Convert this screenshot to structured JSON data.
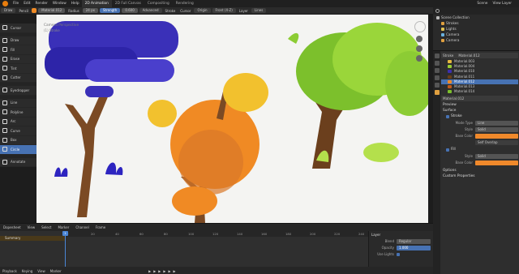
{
  "menubar": {
    "items": [
      "File",
      "Edit",
      "Render",
      "Window",
      "Help"
    ],
    "workspaces": [
      "2D Animation",
      "2D Full Canvas",
      "Compositing",
      "Rendering"
    ],
    "active_workspace": "2D Animation",
    "scene": "Scene",
    "view_layer": "View Layer"
  },
  "toolbar": {
    "mode": "Draw",
    "brush": "Pencil",
    "material": "Material.012",
    "radius_label": "Radius",
    "radius": "24 px",
    "strength_label": "Strength",
    "strength": "0.600",
    "advanced": "Advanced",
    "stroke": "Stroke",
    "cursor": "Cursor",
    "origin": "Origin",
    "front": "Front (X-Z)",
    "layer": "Layer",
    "lines": "Lines"
  },
  "tools": [
    {
      "label": "Cursor",
      "active": false
    },
    {
      "label": "Draw",
      "active": false
    },
    {
      "label": "Fill",
      "active": false
    },
    {
      "label": "Erase",
      "active": false
    },
    {
      "label": "Tint",
      "active": false
    },
    {
      "label": "Cutter",
      "active": false
    },
    {
      "label": "Eyedropper",
      "active": false
    },
    {
      "label": "Line",
      "active": false
    },
    {
      "label": "Polyline",
      "active": false
    },
    {
      "label": "Arc",
      "active": false
    },
    {
      "label": "Curve",
      "active": false
    },
    {
      "label": "Box",
      "active": false
    },
    {
      "label": "Circle",
      "active": true
    },
    {
      "label": "Annotate",
      "active": false
    }
  ],
  "viewport": {
    "label": "Camera Perspective",
    "sub": "(1) Stroke"
  },
  "outliner": {
    "rows": [
      {
        "label": "Scene Collection",
        "sel": false,
        "color": "#bbbbbb"
      },
      {
        "label": "Strokes",
        "sel": false,
        "color": "#e0a040"
      },
      {
        "label": "Lights",
        "sel": false,
        "color": "#e0c050"
      },
      {
        "label": "Camera",
        "sel": false,
        "color": "#6ab0de"
      },
      {
        "label": "Camera",
        "sel": false,
        "color": "#e0a040"
      }
    ]
  },
  "props": {
    "object": "Stroke",
    "material_slot": "Material.012",
    "materials": [
      {
        "label": "Material.003",
        "color": "#e7b83f"
      },
      {
        "label": "Material.004",
        "color": "#9acd32"
      },
      {
        "label": "Material.010",
        "color": "#3d2fb0"
      },
      {
        "label": "Material.011",
        "color": "#6a3f1a"
      },
      {
        "label": "Material.012",
        "color": "#f08a24",
        "sel": true
      },
      {
        "label": "Material.013",
        "color": "#c05a1a"
      },
      {
        "label": "Material.014",
        "color": "#7cc02c"
      }
    ],
    "preview": "Preview",
    "surface": "Surface",
    "stroke_label": "Stroke",
    "mode_type_label": "Mode Type",
    "mode_type": "Line",
    "style_label": "Style",
    "style": "Solid",
    "base_color_label": "Base Color",
    "self_overlap": "Self Overlap",
    "fill_label": "Fill",
    "fill_style_label": "Style",
    "fill_style": "Solid",
    "fill_base_label": "Base Color",
    "options": "Options",
    "custom_props": "Custom Properties",
    "base_color": "#f0892b",
    "fill_color": "#f0892b"
  },
  "timeline": {
    "header": [
      "Dopesheet",
      "View",
      "Select",
      "Marker",
      "Channel",
      "Frame"
    ],
    "summary": "Summary",
    "current_frame": "1",
    "ticks": [
      "0",
      "20",
      "40",
      "60",
      "80",
      "100",
      "120",
      "140",
      "160",
      "180",
      "200",
      "220",
      "240"
    ],
    "footer": [
      "Playback",
      "Keying",
      "View",
      "Marker"
    ]
  },
  "layer_panel": {
    "title": "Layer",
    "blend_label": "Blend",
    "blend": "Regular",
    "opacity_label": "Opacity",
    "opacity": "1.000",
    "use_lights_label": "Use Lights"
  }
}
